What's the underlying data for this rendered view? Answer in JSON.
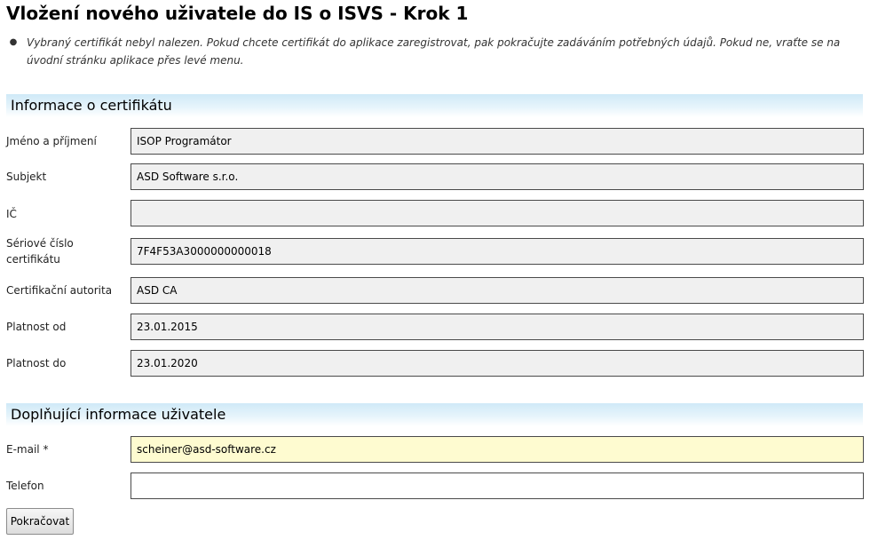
{
  "page": {
    "title": "Vložení nového uživatele do IS o ISVS - Krok 1",
    "notice": "Vybraný certifikát nebyl nalezen. Pokud chcete certifikát do aplikace zaregistrovat, pak pokračujte zadáváním potřebných údajů. Pokud ne, vraťte se na úvodní stránku aplikace přes levé menu.",
    "notice_bullet": "●"
  },
  "certificate": {
    "heading": "Informace o certifikátu",
    "name_label": "Jméno a příjmení",
    "name_value": "ISOP Programátor",
    "subject_label": "Subjekt",
    "subject_value": "ASD Software s.r.o.",
    "ic_label": "IČ",
    "ic_value": "",
    "serial_label": "Sériové číslo certifikátu",
    "serial_value": "7F4F53A3000000000018",
    "authority_label": "Certifikační autorita",
    "authority_value": "ASD CA",
    "valid_from_label": "Platnost od",
    "valid_from_value": "23.01.2015",
    "valid_to_label": "Platnost do",
    "valid_to_value": "23.01.2020"
  },
  "user": {
    "heading": "Doplňující informace uživatele",
    "email_label": "E-mail *",
    "email_value": "scheiner@asd-software.cz",
    "phone_label": "Telefon",
    "phone_value": ""
  },
  "actions": {
    "continue_label": "Pokračovat"
  },
  "colors": {
    "section_header": "#cfe9f7",
    "readonly_field": "#f0f0f0",
    "focused_field": "#fefbd0"
  }
}
